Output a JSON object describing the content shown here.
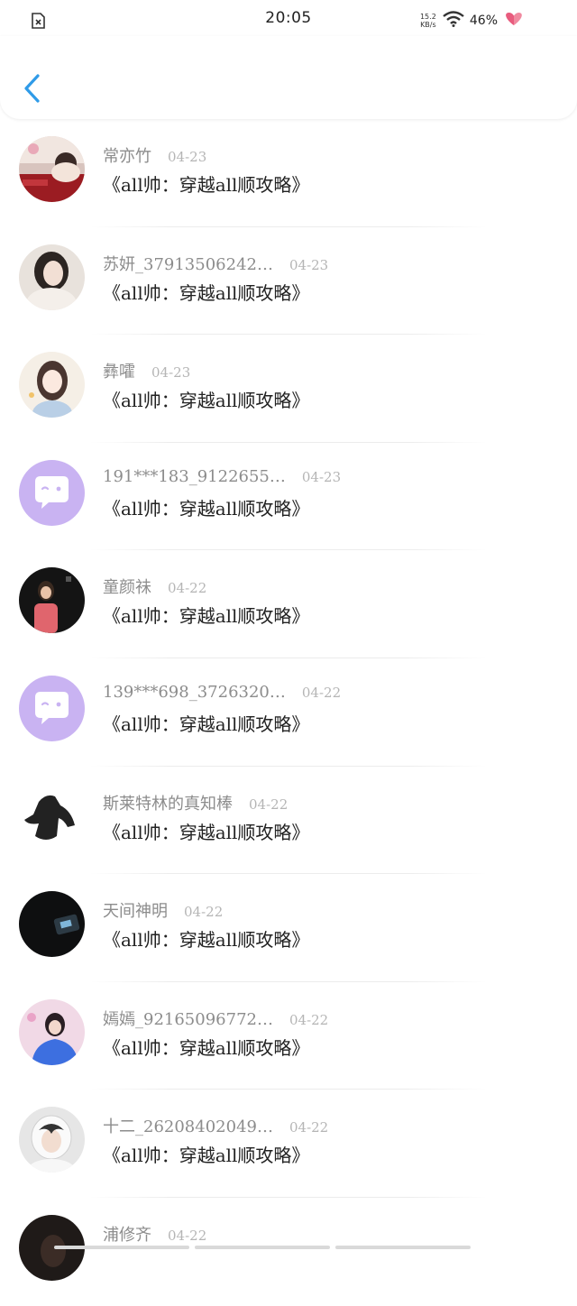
{
  "status_bar": {
    "time": "20:05",
    "net_speed_value": "15.2",
    "net_speed_unit": "KB/s",
    "battery": "46%"
  },
  "header": {
    "back_icon": "chevron-left-icon",
    "accent_color": "#2f9be8"
  },
  "list": [
    {
      "username": "常亦竹",
      "date": "04-23",
      "message": "《all帅：穿越all顺攻略》",
      "avatar": "photo"
    },
    {
      "username": "苏妍_37913506242…",
      "date": "04-23",
      "message": "《all帅：穿越all顺攻略》",
      "avatar": "photo"
    },
    {
      "username": "彝嚯",
      "date": "04-23",
      "message": "《all帅：穿越all顺攻略》",
      "avatar": "photo"
    },
    {
      "username": "191***183_9122655…",
      "date": "04-23",
      "message": "《all帅：穿越all顺攻略》",
      "avatar": "default-chat-bubble-icon"
    },
    {
      "username": "童颜祙",
      "date": "04-22",
      "message": "《all帅：穿越all顺攻略》",
      "avatar": "photo"
    },
    {
      "username": "139***698_3726320…",
      "date": "04-22",
      "message": "《all帅：穿越all顺攻略》",
      "avatar": "default-chat-bubble-icon"
    },
    {
      "username": "斯莱特林的真知棒",
      "date": "04-22",
      "message": "《all帅：穿越all顺攻略》",
      "avatar": "photo"
    },
    {
      "username": "天间神明",
      "date": "04-22",
      "message": "《all帅：穿越all顺攻略》",
      "avatar": "photo"
    },
    {
      "username": "嫣嫣_92165096772…",
      "date": "04-22",
      "message": "《all帅：穿越all顺攻略》",
      "avatar": "photo"
    },
    {
      "username": "十二_26208402049…",
      "date": "04-22",
      "message": "《all帅：穿越all顺攻略》",
      "avatar": "photo"
    },
    {
      "username": "浦修齐",
      "date": "04-22",
      "message": "",
      "avatar": "photo"
    }
  ]
}
